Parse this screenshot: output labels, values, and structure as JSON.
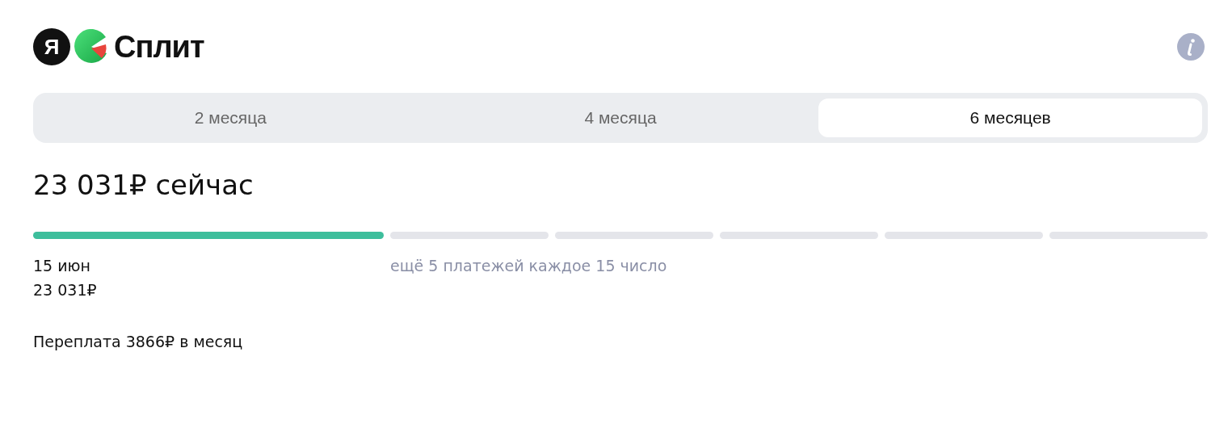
{
  "logo": {
    "mark": "Я",
    "name": "Сплит"
  },
  "tabs": [
    {
      "label": "2 месяца",
      "selected": false
    },
    {
      "label": "4 месяца",
      "selected": false
    },
    {
      "label": "6 месяцев",
      "selected": true
    }
  ],
  "headline": "23 031₽ сейчас",
  "segments": [
    {
      "filled": true
    },
    {
      "filled": false
    },
    {
      "filled": false
    },
    {
      "filled": false
    },
    {
      "filled": false
    },
    {
      "filled": false
    }
  ],
  "first_payment": {
    "date": "15 июн",
    "amount": "23 031₽"
  },
  "remaining_note": "ещё 5 платежей каждое 15 число",
  "overpayment": "Переплата 3866₽ в месяц"
}
